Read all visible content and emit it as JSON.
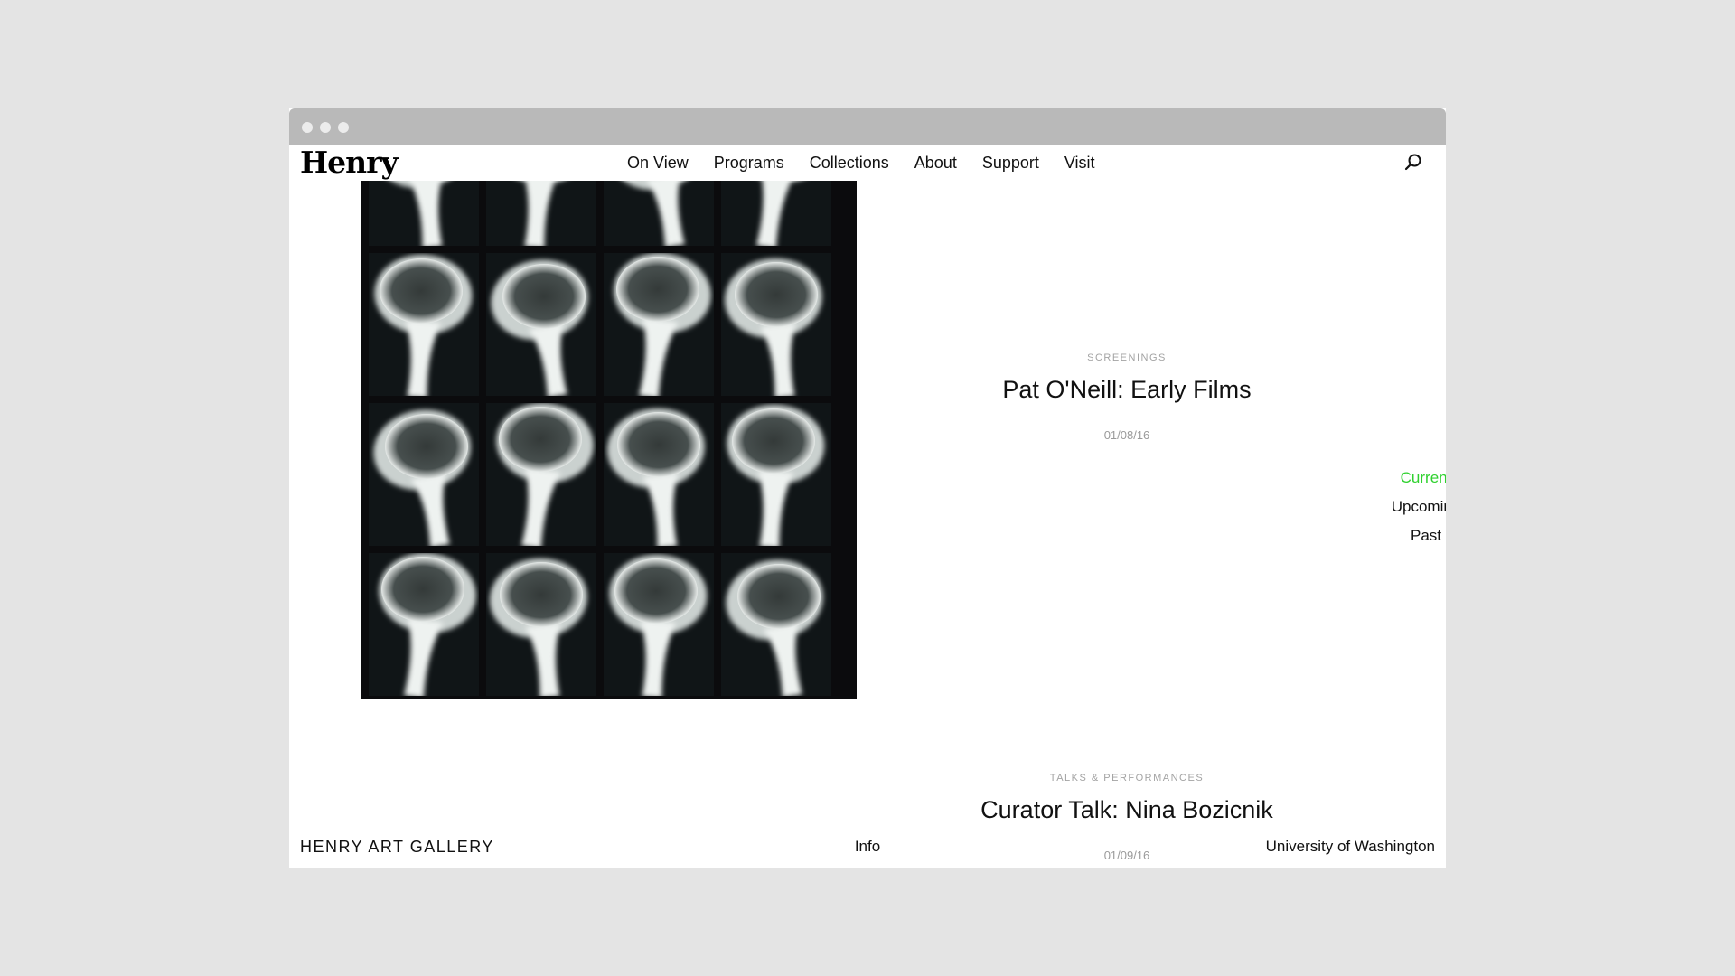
{
  "header": {
    "logo": "Henry",
    "nav": [
      "On View",
      "Programs",
      "Collections",
      "About",
      "Support",
      "Visit"
    ],
    "search_icon": "search-icon"
  },
  "events": [
    {
      "category": "SCREENINGS",
      "title": "Pat O'Neill: Early Films",
      "date": "01/08/16"
    },
    {
      "category": "TALKS & PERFORMANCES",
      "title": "Curator Talk: Nina Bozicnik",
      "date": "01/09/16"
    }
  ],
  "filters": {
    "items": [
      "Current",
      "Upcoming",
      "Past"
    ],
    "active": "Current",
    "active_color": "#2fd12f"
  },
  "footer": {
    "left": "HENRY ART GALLERY",
    "center": "Info",
    "right": "University of Washington"
  },
  "colors": {
    "background": "#e4e4e4",
    "titlebar": "#b9b9b9",
    "meta_text": "#a3a3a3"
  }
}
